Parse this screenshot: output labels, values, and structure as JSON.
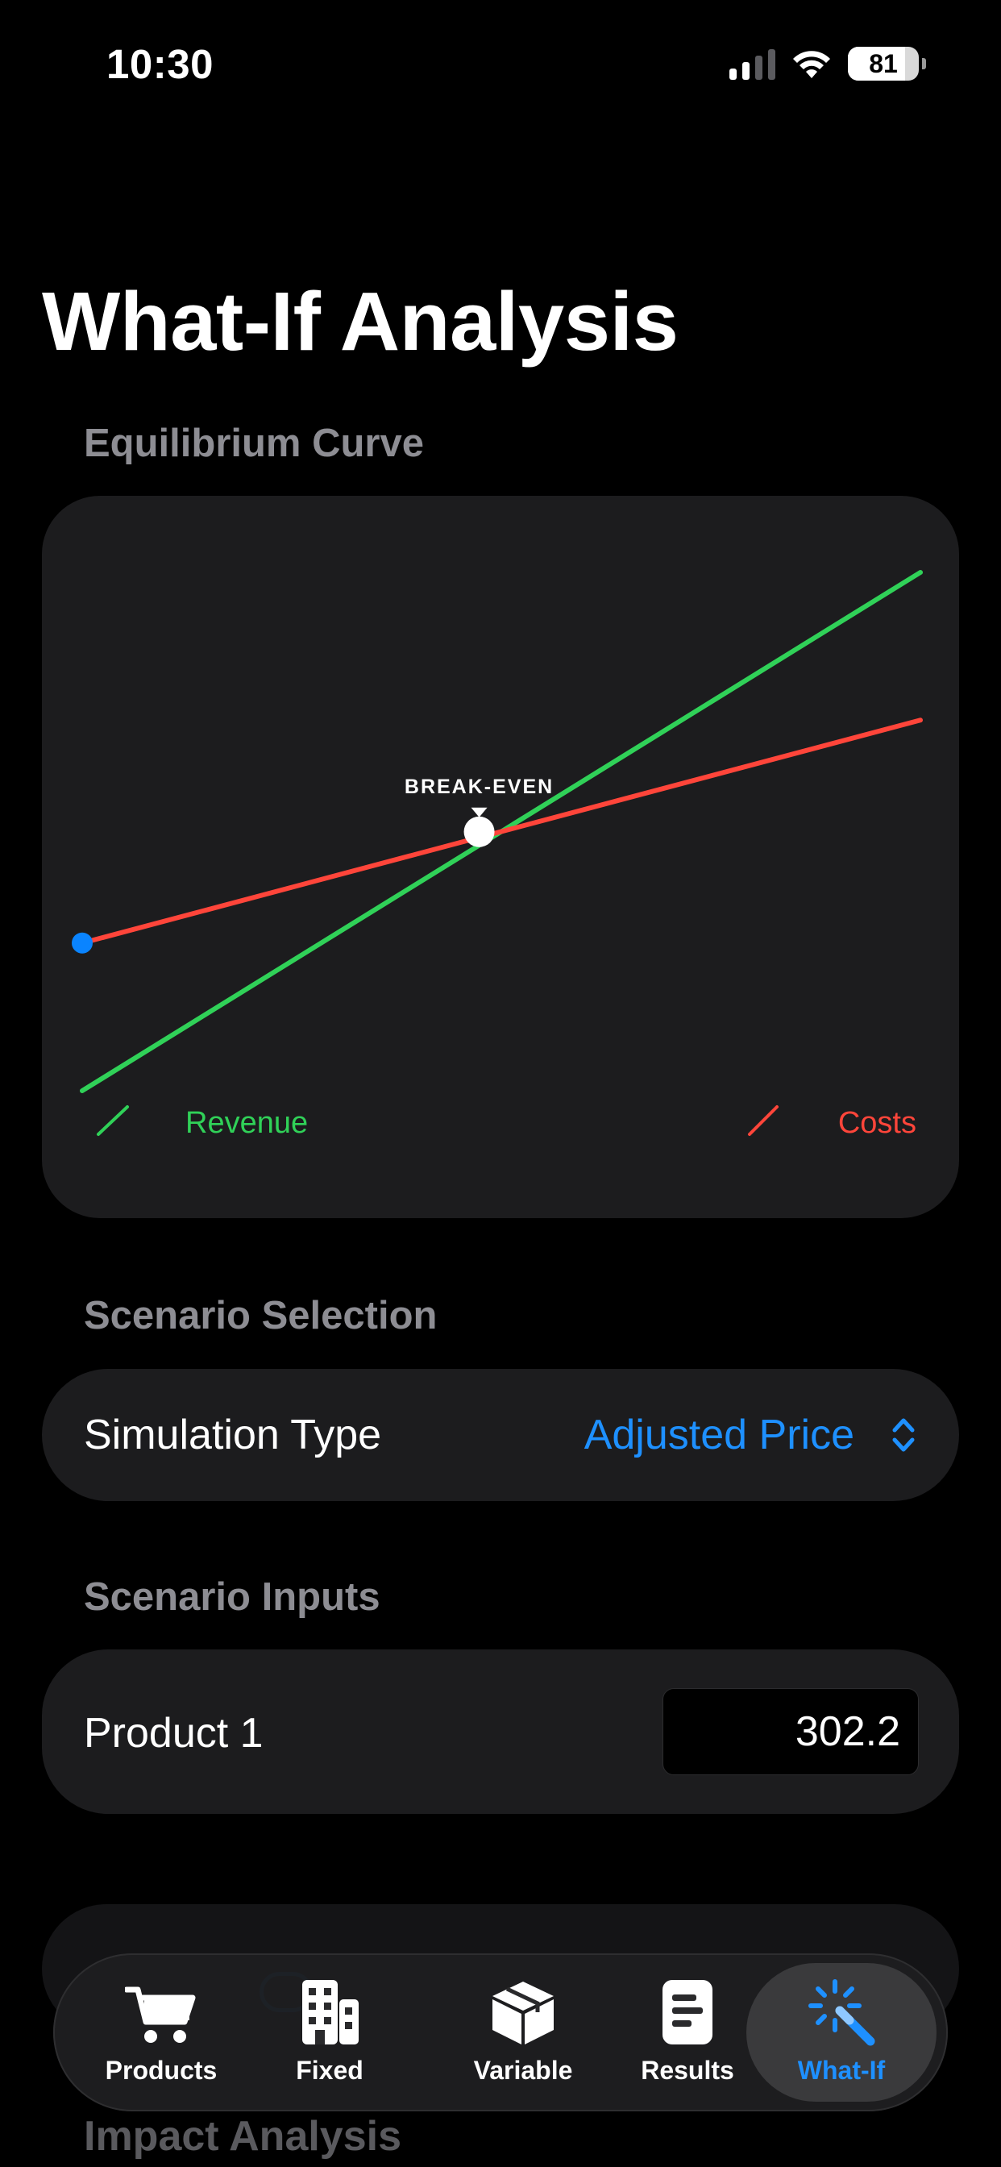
{
  "status_bar": {
    "time": "10:30",
    "battery_level": "81",
    "signal_bars_active": 2
  },
  "page": {
    "title": "What-If Analysis"
  },
  "chart_section": {
    "label": "Equilibrium Curve"
  },
  "chart_data": {
    "type": "line",
    "x": [
      0,
      1
    ],
    "series": [
      {
        "name": "Revenue",
        "values": [
          0,
          1
        ],
        "color": "#30d158"
      },
      {
        "name": "Costs",
        "values": [
          0.285,
          0.715
        ],
        "color": "#ff453a"
      }
    ],
    "start_marker_color": "#0a84ff",
    "annotation": {
      "text": "BREAK-EVEN",
      "x": 0.4736,
      "y": 0.4996
    },
    "ylim": [
      0,
      1
    ],
    "xlim": [
      0,
      1
    ],
    "grid": false,
    "legend_position": "bottom"
  },
  "scenario_selection": {
    "label": "Scenario Selection",
    "simulation_type_label": "Simulation Type",
    "simulation_type_value": "Adjusted Price"
  },
  "scenario_inputs": {
    "label": "Scenario Inputs",
    "items": [
      {
        "name": "Product 1",
        "value": "302.2"
      }
    ]
  },
  "impact_section": {
    "label": "Impact Analysis"
  },
  "tabbar": {
    "tabs": [
      {
        "label": "Products",
        "icon": "cart-icon"
      },
      {
        "label": "Fixed",
        "icon": "building-icon"
      },
      {
        "label": "Variable",
        "icon": "box-icon"
      },
      {
        "label": "Results",
        "icon": "document-icon"
      },
      {
        "label": "What-If",
        "icon": "magic-wand-icon"
      }
    ],
    "active": "What-If",
    "active_color": "#1e90ff"
  }
}
